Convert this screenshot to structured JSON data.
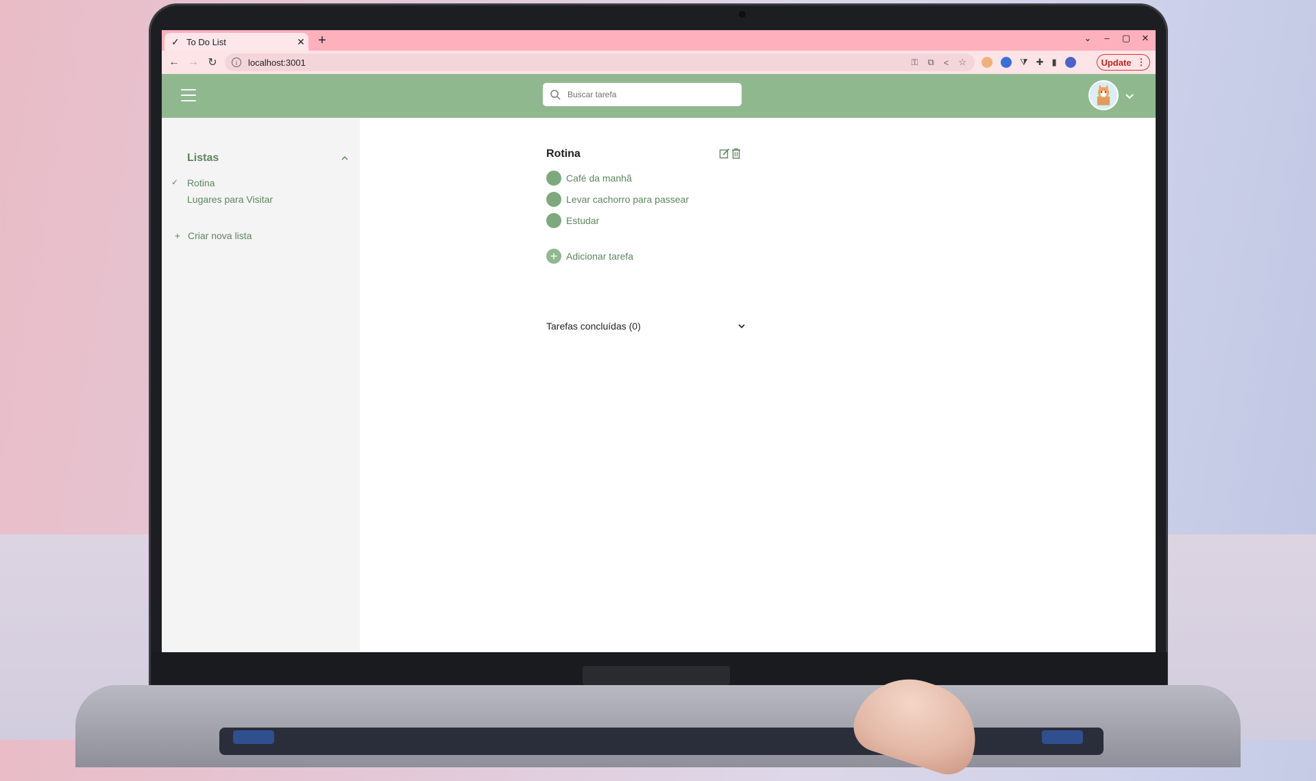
{
  "browser": {
    "tab_title": "To Do List",
    "tab_icon": "check-icon",
    "url": "localhost:3001",
    "update_label": "Update"
  },
  "app": {
    "colors": {
      "header": "#8fb88f",
      "accent_text": "#5e845e",
      "task_circle": "#7ea97e"
    },
    "search": {
      "placeholder": "Buscar tarefa"
    },
    "sidebar": {
      "title": "Listas",
      "lists": [
        {
          "label": "Rotina",
          "selected": true
        },
        {
          "label": "Lugares para Visitar",
          "selected": false
        }
      ],
      "new_list_label": "Criar nova lista"
    },
    "main": {
      "list_title": "Rotina",
      "tasks": [
        {
          "label": "Café da manhã"
        },
        {
          "label": "Levar cachorro para passear"
        },
        {
          "label": "Estudar"
        }
      ],
      "add_task_label": "Adicionar tarefa",
      "completed_label": "Tarefas concluídas (0)"
    }
  }
}
